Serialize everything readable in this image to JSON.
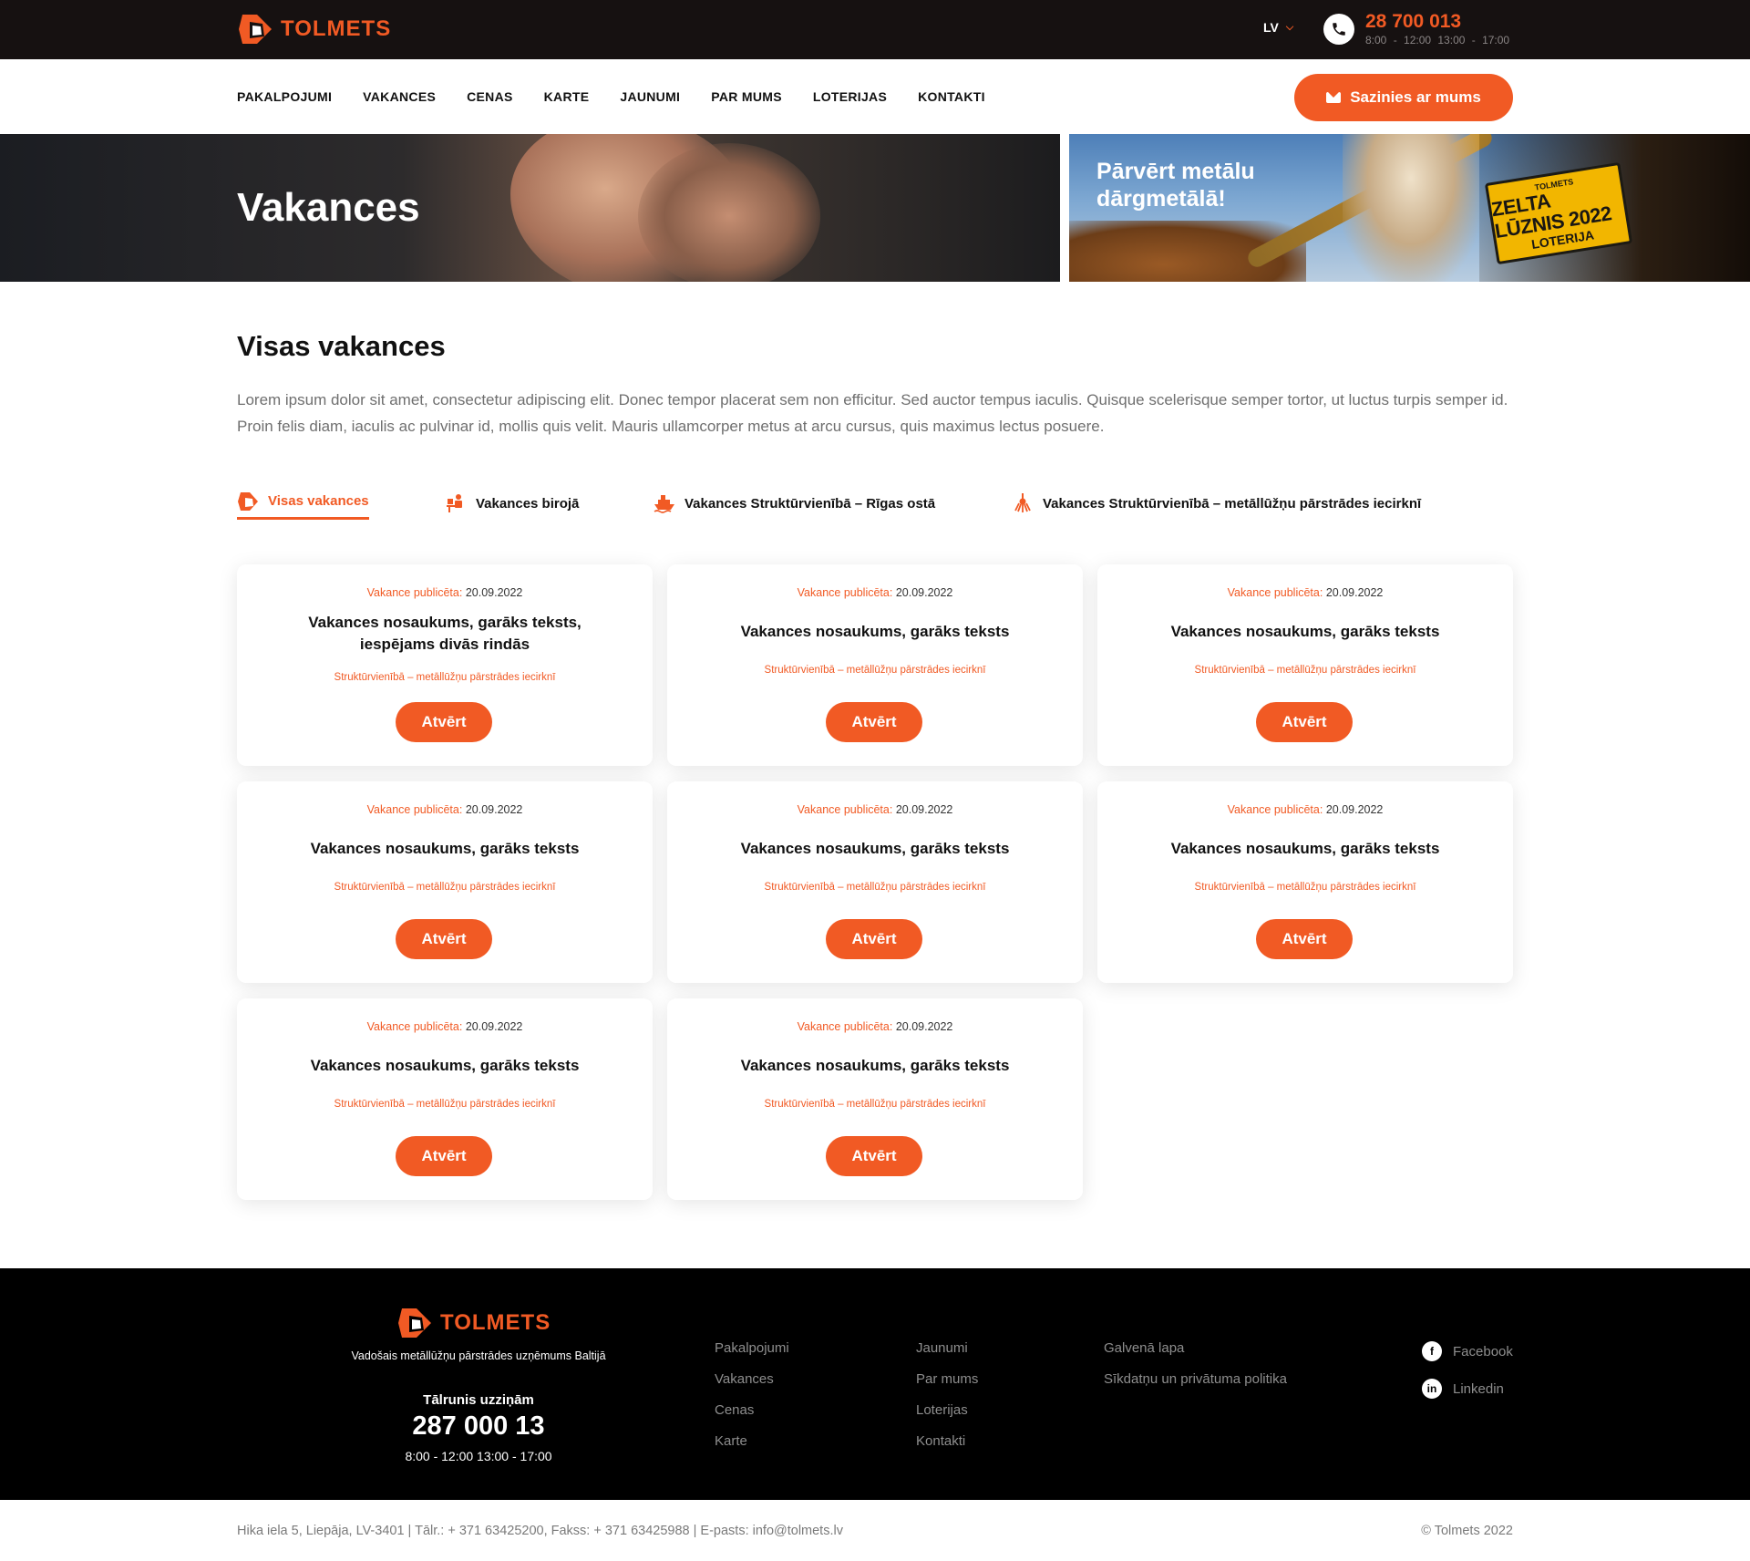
{
  "brand": {
    "name": "TOLMETS",
    "accent": "#f15a24",
    "dark": "#161111"
  },
  "topbar": {
    "lang": "LV",
    "phone": "28 700 013",
    "hours": "8:00 - 12:00   13:00 - 17:00"
  },
  "nav": {
    "items": [
      "PAKALPOJUMI",
      "VAKANCES",
      "CENAS",
      "KARTE",
      "JAUNUMI",
      "PAR MUMS",
      "LOTERIJAS",
      "KONTAKTI"
    ],
    "cta": "Sazinies ar mums"
  },
  "hero": {
    "title": "Vakances"
  },
  "promo": {
    "text": "Pārvērt metālu dārgmetālā!",
    "badge_brand": "TOLMETS",
    "badge_title": "ZELTA LŪZNIS 2022",
    "badge_sub": "LOTERIJA"
  },
  "main": {
    "title": "Visas vakances",
    "lead": "Lorem ipsum dolor sit amet, consectetur adipiscing elit. Donec tempor placerat sem non efficitur. Sed auctor tempus iaculis. Quisque scelerisque semper tortor, ut luctus turpis semper id. Proin felis diam, iaculis ac pulvinar id, mollis quis velit. Mauris ullamcorper metus at arcu cursus, quis maximus lectus posuere.",
    "tabs": [
      {
        "label": "Visas vakances",
        "icon": "tolmets-logo-icon"
      },
      {
        "label": "Vakances birojā",
        "icon": "office-worker-icon"
      },
      {
        "label": "Vakances Struktūrvienībā – Rīgas ostā",
        "icon": "ship-icon"
      },
      {
        "label": "Vakances Struktūrvienībā – metāllūžņu pārstrādes iecirknī",
        "icon": "claw-crane-icon"
      }
    ]
  },
  "cards": [
    {
      "pub_label": "Vakance publicēta:",
      "date": "20.09.2022",
      "title": "Vakances nosaukums, garāks teksts, iespējams divās rindās",
      "unit": "Struktūrvienībā – metāllūžņu pārstrādes iecirknī",
      "button": "Atvērt"
    },
    {
      "pub_label": "Vakance publicēta:",
      "date": "20.09.2022",
      "title": "Vakances nosaukums, garāks teksts",
      "unit": "Struktūrvienībā – metāllūžņu pārstrādes iecirknī",
      "button": "Atvērt"
    },
    {
      "pub_label": "Vakance publicēta:",
      "date": "20.09.2022",
      "title": "Vakances nosaukums, garāks teksts",
      "unit": "Struktūrvienībā – metāllūžņu pārstrādes iecirknī",
      "button": "Atvērt"
    },
    {
      "pub_label": "Vakance publicēta:",
      "date": "20.09.2022",
      "title": "Vakances nosaukums, garāks teksts",
      "unit": "Struktūrvienībā – metāllūžņu pārstrādes iecirknī",
      "button": "Atvērt"
    },
    {
      "pub_label": "Vakance publicēta:",
      "date": "20.09.2022",
      "title": "Vakances nosaukums, garāks teksts",
      "unit": "Struktūrvienībā – metāllūžņu pārstrādes iecirknī",
      "button": "Atvērt"
    },
    {
      "pub_label": "Vakance publicēta:",
      "date": "20.09.2022",
      "title": "Vakances nosaukums, garāks teksts",
      "unit": "Struktūrvienībā – metāllūžņu pārstrādes iecirknī",
      "button": "Atvērt"
    },
    {
      "pub_label": "Vakance publicēta:",
      "date": "20.09.2022",
      "title": "Vakances nosaukums, garāks teksts",
      "unit": "Struktūrvienībā – metāllūžņu pārstrādes iecirknī",
      "button": "Atvērt"
    },
    {
      "pub_label": "Vakance publicēta:",
      "date": "20.09.2022",
      "title": "Vakances nosaukums, garāks teksts",
      "unit": "Struktūrvienībā – metāllūžņu pārstrādes iecirknī",
      "button": "Atvērt"
    }
  ],
  "footer": {
    "tagline": "Vadošais metāllūžņu pārstrādes uzņēmums Baltijā",
    "phone_label": "Tālrunis uzziņām",
    "phone": "287 000 13",
    "hours": "8:00 - 12:00 13:00 - 17:00",
    "col1": [
      "Pakalpojumi",
      "Vakances",
      "Cenas",
      "Karte"
    ],
    "col2": [
      "Jaunumi",
      "Par mums",
      "Loterijas",
      "Kontakti"
    ],
    "col3": [
      "Galvenā lapa",
      "Sīkdatņu un privātuma politika"
    ],
    "social": [
      {
        "label": "Facebook",
        "icon": "facebook-icon"
      },
      {
        "label": "Linkedin",
        "icon": "linkedin-icon"
      }
    ]
  },
  "bottom": {
    "address": "Hika iela 5, Liepāja, LV-3401 | Tālr.: + 371 63425200, Fakss: + 371 63425988 | E-pasts: info@tolmets.lv",
    "copyright": "© Tolmets 2022"
  }
}
